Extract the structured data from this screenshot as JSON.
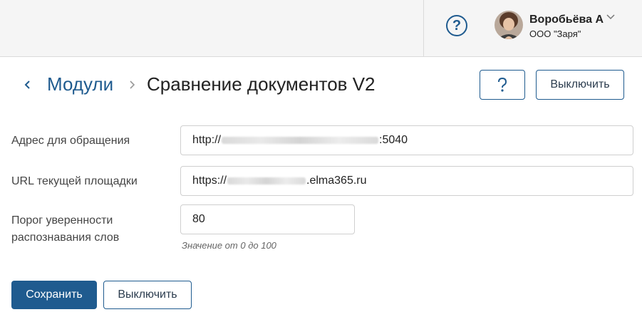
{
  "header": {
    "help_icon": "question-circle-icon",
    "user": {
      "name": "Воробьёва А",
      "org": "ООО \"Заря\"",
      "avatar_icon": "user-avatar"
    }
  },
  "breadcrumb": {
    "back_icon": "chevron-left-icon",
    "parent": "Модули",
    "separator_icon": "chevron-right-icon",
    "current": "Сравнение документов V2"
  },
  "toolbar": {
    "help_icon": "question-icon",
    "disable_label": "Выключить"
  },
  "form": {
    "address": {
      "label": "Адрес для обращения",
      "value_prefix": "http://",
      "value_suffix": ":5040"
    },
    "site_url": {
      "label": "URL текущей площадки",
      "value_prefix": "https://",
      "value_suffix": ".elma365.ru"
    },
    "threshold": {
      "label_line1": "Порог уверенности",
      "label_line2": "распознавания слов",
      "value": "80",
      "hint": "Значение от 0 до 100"
    }
  },
  "actions": {
    "save_label": "Сохранить",
    "disable_label": "Выключить"
  },
  "colors": {
    "accent": "#1f5b8f",
    "header_bg": "#f5f5f5",
    "border": "#cfcfcf"
  }
}
